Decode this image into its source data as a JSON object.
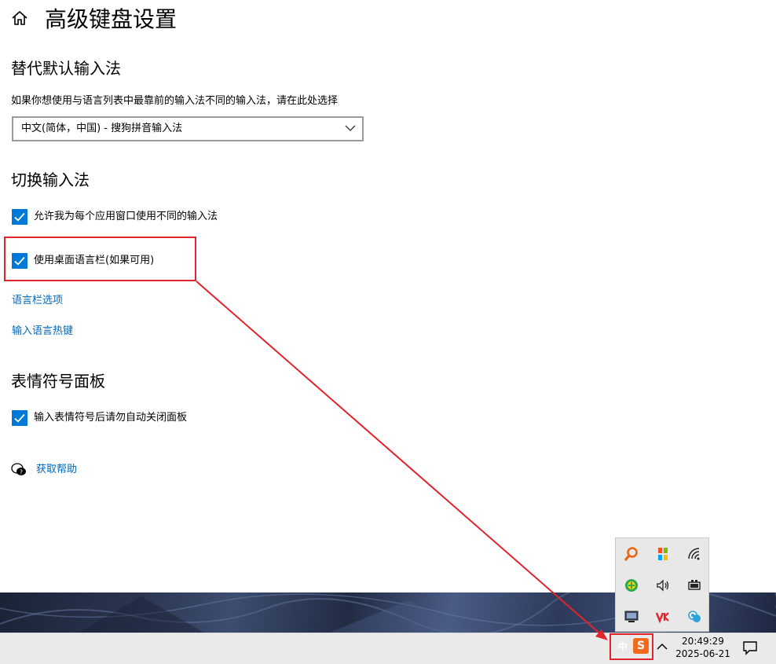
{
  "page": {
    "title": "高级键盘设置"
  },
  "override_section": {
    "heading": "替代默认输入法",
    "description": "如果你想使用与语言列表中最靠前的输入法不同的输入法，请在此处选择",
    "dropdown_value": "中文(简体，中国) - 搜狗拼音输入法"
  },
  "switch_section": {
    "heading": "切换输入法",
    "per_app_checkbox_label": "允许我为每个应用窗口使用不同的输入法",
    "desktop_bar_checkbox_label": "使用桌面语言栏(如果可用)",
    "language_bar_options_link": "语言栏选项",
    "hotkeys_link": "输入语言热键"
  },
  "emoji_section": {
    "heading": "表情符号面板",
    "auto_close_checkbox_label": "输入表情符号后请勿自动关闭面板"
  },
  "help": {
    "link": "获取帮助"
  },
  "taskbar": {
    "time": "20:49:29",
    "date": "2025-06-21",
    "lang_indicator": "中",
    "ime_badge": "S"
  },
  "tray_icons": [
    "search-tool-icon",
    "color-tiles-icon",
    "wifi-icon",
    "security-plus-icon",
    "volume-icon",
    "battery-icon",
    "monitor-icon",
    "vk-icon",
    "cloud-people-icon"
  ],
  "colors": {
    "accent": "#0078d7",
    "link": "#0067b8",
    "annotation": "#e0252c",
    "ime_orange": "#f26b1d"
  }
}
